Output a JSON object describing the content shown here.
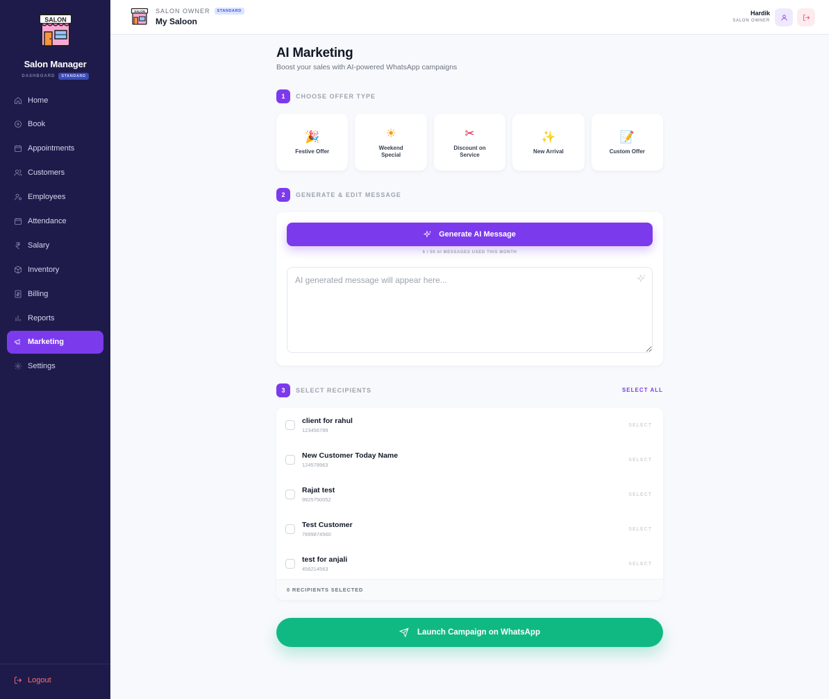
{
  "brand": {
    "logo_text": "SALON",
    "name": "Salon Manager",
    "dashboard_label": "DASHBOARD",
    "plan_badge": "STANDARD"
  },
  "sidebar": {
    "items": [
      {
        "label": "Home",
        "icon": "home-icon"
      },
      {
        "label": "Book",
        "icon": "plus-circle-icon"
      },
      {
        "label": "Appointments",
        "icon": "calendar-icon"
      },
      {
        "label": "Customers",
        "icon": "users-icon"
      },
      {
        "label": "Employees",
        "icon": "user-cog-icon"
      },
      {
        "label": "Attendance",
        "icon": "calendar-check-icon"
      },
      {
        "label": "Salary",
        "icon": "rupee-icon"
      },
      {
        "label": "Inventory",
        "icon": "box-icon"
      },
      {
        "label": "Billing",
        "icon": "receipt-icon"
      },
      {
        "label": "Reports",
        "icon": "bar-chart-icon"
      },
      {
        "label": "Marketing",
        "icon": "megaphone-icon",
        "active": true
      },
      {
        "label": "Settings",
        "icon": "gear-icon"
      }
    ],
    "logout_label": "Logout"
  },
  "header": {
    "role": "SALON OWNER",
    "plan_badge": "STANDARD",
    "title": "My Saloon",
    "user_name": "Hardik",
    "user_role": "SALON OWNER"
  },
  "main": {
    "title": "AI Marketing",
    "subtitle": "Boost your sales with AI-powered WhatsApp campaigns",
    "step1": {
      "num": "1",
      "label": "CHOOSE OFFER TYPE"
    },
    "offers": [
      {
        "emoji": "🎉",
        "label": "Festive Offer"
      },
      {
        "emoji": "☀",
        "label": "Weekend Special"
      },
      {
        "emoji": "✂",
        "label": "Discount on Service"
      },
      {
        "emoji": "✨",
        "label": "New Arrival"
      },
      {
        "emoji": "📝",
        "label": "Custom Offer"
      }
    ],
    "step2": {
      "num": "2",
      "label": "GENERATE & EDIT MESSAGE"
    },
    "generate_button": "Generate AI Message",
    "usage_text": "6 / 50 AI MESSAGES USED THIS MONTH",
    "message_placeholder": "AI generated message will appear here...",
    "message_value": "",
    "step3": {
      "num": "3",
      "label": "SELECT RECIPIENTS"
    },
    "select_all": "SELECT ALL",
    "recipients": [
      {
        "name": "client for rahul",
        "phone": "123456789",
        "action": "SELECT",
        "checked": false
      },
      {
        "name": "New Customer Today Name",
        "phone": "124578963",
        "action": "SELECT",
        "checked": false
      },
      {
        "name": "Rajat test",
        "phone": "9925750052",
        "action": "SELECT",
        "checked": false
      },
      {
        "name": "Test Customer",
        "phone": "7899874560",
        "action": "SELECT",
        "checked": false
      },
      {
        "name": "test for anjali",
        "phone": "456214563",
        "action": "SELECT",
        "checked": false
      }
    ],
    "selected_count_text": "0 RECIPIENTS SELECTED",
    "launch_button": "Launch Campaign on WhatsApp"
  },
  "colors": {
    "sidebar_bg": "#1e1b4b",
    "accent": "#7c3aed",
    "launch": "#10b981",
    "logout": "#f87171"
  }
}
